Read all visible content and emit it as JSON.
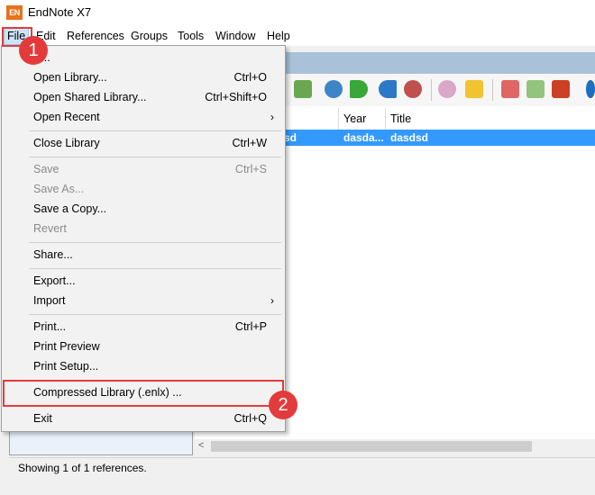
{
  "window": {
    "app_icon_text": "EN",
    "title": "EndNote X7"
  },
  "menubar": [
    "File",
    "Edit",
    "References",
    "Groups",
    "Tools",
    "Window",
    "Help"
  ],
  "file_menu": {
    "items": [
      {
        "label": "New...",
        "visible_label": "w...",
        "shortcut": "",
        "disabled": false
      },
      {
        "label": "Open Library...",
        "shortcut": "Ctrl+O",
        "disabled": false
      },
      {
        "label": "Open Shared Library...",
        "shortcut": "Ctrl+Shift+O",
        "disabled": false
      },
      {
        "label": "Open Recent",
        "shortcut": "",
        "submenu": true,
        "disabled": false
      },
      {
        "label": "Close Library",
        "shortcut": "Ctrl+W",
        "disabled": false
      },
      {
        "label": "Save",
        "shortcut": "Ctrl+S",
        "disabled": true
      },
      {
        "label": "Save As...",
        "shortcut": "",
        "disabled": true
      },
      {
        "label": "Save a Copy...",
        "shortcut": "",
        "disabled": false
      },
      {
        "label": "Revert",
        "shortcut": "",
        "disabled": true
      },
      {
        "label": "Share...",
        "shortcut": "",
        "disabled": false
      },
      {
        "label": "Export...",
        "shortcut": "",
        "disabled": false
      },
      {
        "label": "Import",
        "shortcut": "",
        "submenu": true,
        "disabled": false
      },
      {
        "label": "Print...",
        "shortcut": "Ctrl+P",
        "disabled": false
      },
      {
        "label": "Print Preview",
        "shortcut": "",
        "disabled": false
      },
      {
        "label": "Print Setup...",
        "shortcut": "",
        "disabled": false
      },
      {
        "label": "Compressed Library (.enlx) ...",
        "shortcut": "",
        "disabled": false
      },
      {
        "label": "Exit",
        "shortcut": "Ctrl+Q",
        "disabled": false
      }
    ]
  },
  "callouts": [
    "1",
    "2"
  ],
  "reference_list": {
    "columns": [
      "Year",
      "Title"
    ],
    "rows": [
      {
        "author_fragment": "sd",
        "year": "dasda...",
        "title": "dasdsd"
      }
    ]
  },
  "status": "Showing 1 of 1 references.",
  "colors": {
    "accent_red": "#e33b3b",
    "selection_blue": "#3399ff",
    "menu_highlight": "#cce4f7"
  }
}
